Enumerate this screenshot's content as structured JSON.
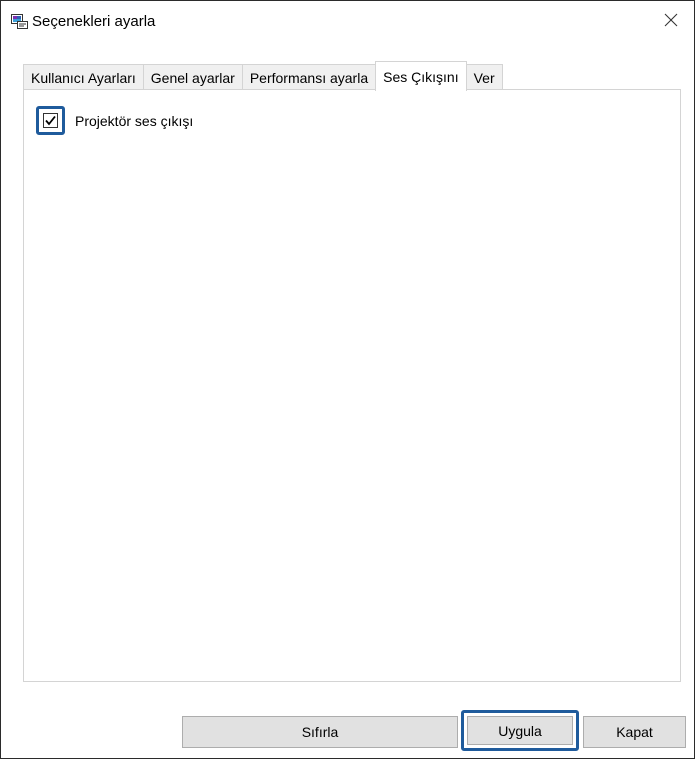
{
  "window": {
    "title": "Seçenekleri ayarla",
    "app_icon": "settings-app-icon",
    "close_icon": "close-icon",
    "close_glyph": "✕"
  },
  "tabs": [
    {
      "label": "Kullanıcı Ayarları",
      "active": false
    },
    {
      "label": "Genel ayarlar",
      "active": false
    },
    {
      "label": "Performansı ayarla",
      "active": false
    },
    {
      "label": "Ses Çıkışını",
      "active": true
    },
    {
      "label": "Ver",
      "active": false
    }
  ],
  "panel": {
    "checkbox": {
      "label": "Projektör ses çıkışı",
      "checked": true,
      "check_glyph": "✔"
    }
  },
  "buttons": {
    "reset_label": "Sıfırla",
    "apply_label": "Uygula",
    "close_label": "Kapat"
  },
  "colors": {
    "highlight": "#1f5b9c",
    "button_bg": "#e1e1e1",
    "tab_inactive_bg": "#f0f0f0"
  }
}
